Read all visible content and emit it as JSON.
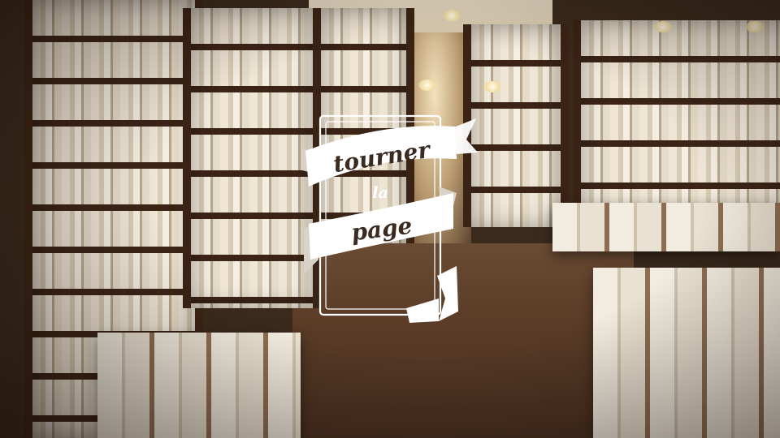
{
  "logo": {
    "line1": "tourner",
    "line2": "la",
    "line3": "page",
    "ribbon_color": "#ffffff",
    "text_color": "#3a2a1f",
    "frame_color": "#ffffff"
  },
  "scene": {
    "wall_color": "#3a2a1c",
    "floor_color": "#5a3c27",
    "shelf_wood_color": "#3a2314",
    "book_color": "#efe6d6"
  }
}
